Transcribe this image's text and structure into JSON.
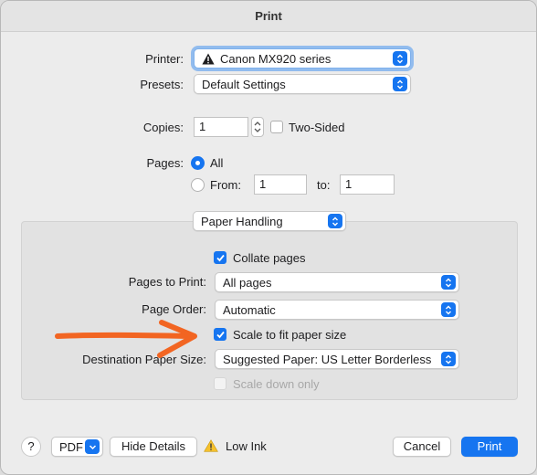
{
  "window": {
    "title": "Print"
  },
  "printer": {
    "label": "Printer:",
    "value": "Canon MX920 series"
  },
  "presets": {
    "label": "Presets:",
    "value": "Default Settings"
  },
  "copies": {
    "label": "Copies:",
    "value": "1",
    "two_sided_label": "Two-Sided",
    "two_sided_checked": false
  },
  "pages": {
    "label": "Pages:",
    "all_label": "All",
    "all_selected": true,
    "from_label": "From:",
    "from_value": "1",
    "to_label": "to:",
    "to_value": "1"
  },
  "section_popup": {
    "value": "Paper Handling"
  },
  "paper_handling": {
    "collate_label": "Collate pages",
    "collate_checked": true,
    "pages_to_print_label": "Pages to Print:",
    "pages_to_print_value": "All pages",
    "page_order_label": "Page Order:",
    "page_order_value": "Automatic",
    "scale_label": "Scale to fit paper size",
    "scale_checked": true,
    "destination_label": "Destination Paper Size:",
    "destination_value": "Suggested Paper: US Letter Borderless",
    "scale_down_label": "Scale down only",
    "scale_down_checked": false
  },
  "footer": {
    "help_label": "?",
    "pdf_label": "PDF",
    "hide_details_label": "Hide Details",
    "low_ink_label": "Low Ink",
    "cancel_label": "Cancel",
    "print_label": "Print"
  },
  "colors": {
    "accent": "#1675f0",
    "annotation_arrow": "#f26522"
  },
  "icons": {
    "printer_warning": "warning-triangle-icon",
    "low_ink": "warning-triangle-icon"
  }
}
